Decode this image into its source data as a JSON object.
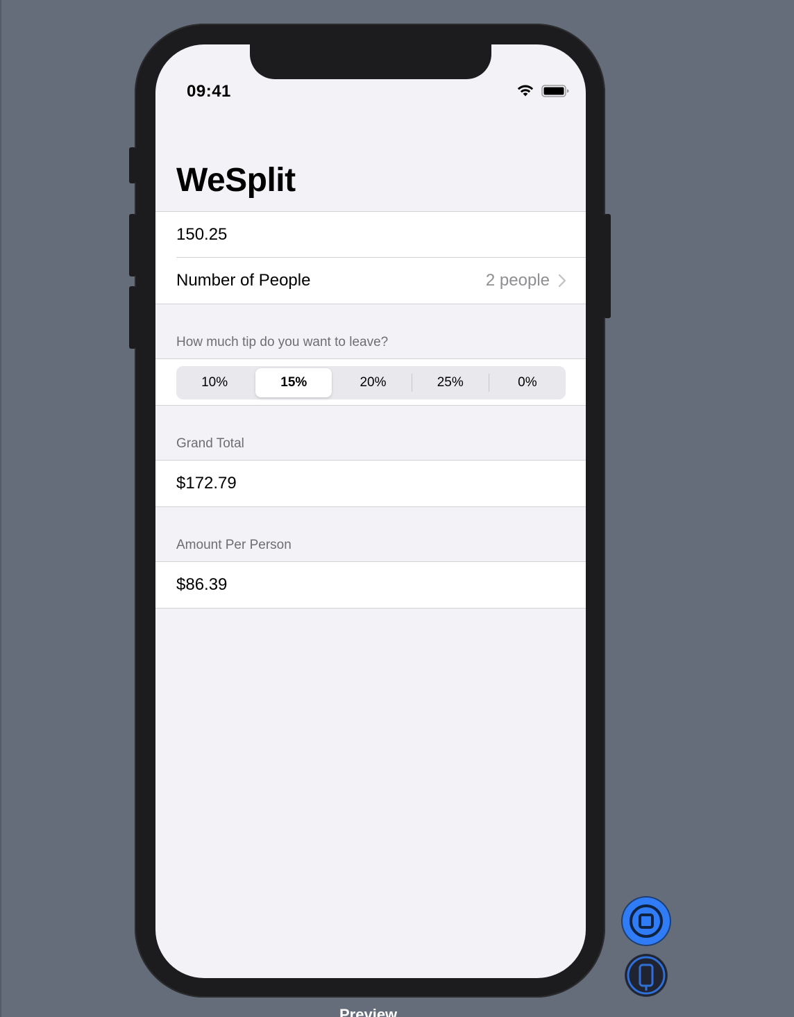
{
  "status_bar": {
    "time": "09:41"
  },
  "nav": {
    "title": "WeSplit"
  },
  "form": {
    "amount_value": "150.25",
    "people_label": "Number of People",
    "people_value": "2 people"
  },
  "tip_section": {
    "header": "How much tip do you want to leave?",
    "options": [
      "10%",
      "15%",
      "20%",
      "25%",
      "0%"
    ],
    "selected": "15%"
  },
  "grand_total_section": {
    "header": "Grand Total",
    "value": "$172.79"
  },
  "per_person_section": {
    "header": "Amount Per Person",
    "value": "$86.39"
  },
  "canvas_footer": {
    "label": "Preview"
  },
  "colors": {
    "canvas": "#646d79",
    "screen_bg": "#f2f2f7",
    "accent_blue": "#2f7cf6"
  }
}
